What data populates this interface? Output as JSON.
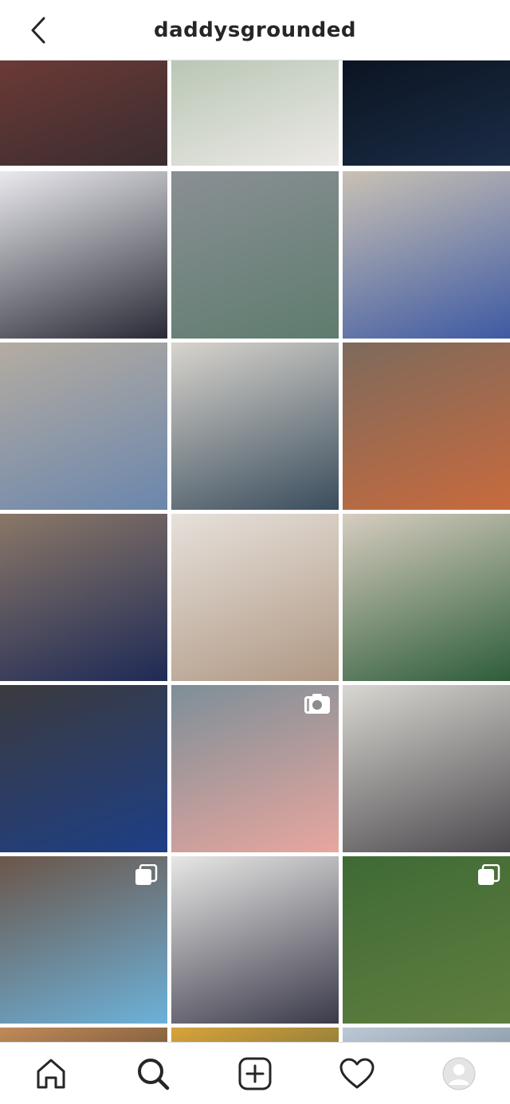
{
  "header": {
    "title": "daddysgrounded",
    "back_icon": "chevron-left-icon"
  },
  "grid": {
    "rows": [
      [
        {
          "name": "post-masked-man-festival-shirt",
          "colors": [
            "#6b3a36",
            "#3a2c30"
          ],
          "overlay": null
        },
        {
          "name": "post-cake-closeup",
          "colors": [
            "#b9c7b5",
            "#ece9e6"
          ],
          "overlay": null
        },
        {
          "name": "post-car-dashboard",
          "colors": [
            "#0b1422",
            "#1b2c46"
          ],
          "overlay": null
        }
      ],
      [
        {
          "name": "post-tv-video-game",
          "colors": [
            "#e9e9ee",
            "#2a2a36"
          ],
          "overlay": null
        },
        {
          "name": "post-boy-controller-bunkbed",
          "colors": [
            "#8a8f94",
            "#5e7c6e"
          ],
          "overlay": null
        },
        {
          "name": "post-boy-kart-shirt",
          "colors": [
            "#c9c1b4",
            "#3e5aa3"
          ],
          "overlay": null
        }
      ],
      [
        {
          "name": "post-boy-on-floor",
          "colors": [
            "#b4aca1",
            "#6b86ad"
          ],
          "overlay": null
        },
        {
          "name": "post-boy-typewriter",
          "colors": [
            "#d8d4cd",
            "#3a4d5d"
          ],
          "overlay": null
        },
        {
          "name": "post-boys-baking",
          "colors": [
            "#7e6a5c",
            "#c86a3d"
          ],
          "overlay": null
        }
      ],
      [
        {
          "name": "post-boy-very-merry",
          "colors": [
            "#8a7767",
            "#1e2a56"
          ],
          "overlay": null
        },
        {
          "name": "post-video-call-collage",
          "colors": [
            "#e6e1db",
            "#b09884"
          ],
          "overlay": null
        },
        {
          "name": "post-boys-christmas-tree",
          "colors": [
            "#d7cdc0",
            "#2e5d3a"
          ],
          "overlay": null
        }
      ],
      [
        {
          "name": "post-boy-globe-tv",
          "colors": [
            "#3b3a3e",
            "#1d3f86"
          ],
          "overlay": null
        },
        {
          "name": "post-boy-laughing",
          "colors": [
            "#7d8f98",
            "#e8a69e"
          ],
          "overlay": "video-icon"
        },
        {
          "name": "post-boys-piano",
          "colors": [
            "#d9d7d1",
            "#4c4a4e"
          ],
          "overlay": null
        }
      ],
      [
        {
          "name": "post-woman-zoom-call",
          "colors": [
            "#6b564a",
            "#6cb1d9"
          ],
          "overlay": "carousel-icon"
        },
        {
          "name": "post-couple-photo",
          "colors": [
            "#e8e7e5",
            "#3b3a4a"
          ],
          "overlay": null
        },
        {
          "name": "post-leaves-lawn",
          "colors": [
            "#3f6a35",
            "#5f7e3f"
          ],
          "overlay": "carousel-icon"
        }
      ],
      [
        {
          "name": "post-partial-row-1",
          "colors": [
            "#c18a5a",
            "#7a5a3a"
          ],
          "overlay": null
        },
        {
          "name": "post-partial-row-2",
          "colors": [
            "#d9a33a",
            "#8a7a3a"
          ],
          "overlay": null
        },
        {
          "name": "post-partial-row-3",
          "colors": [
            "#bcc8d6",
            "#8a9aa8"
          ],
          "overlay": null
        }
      ]
    ]
  },
  "nav": {
    "items": [
      {
        "name": "home",
        "icon": "home-icon"
      },
      {
        "name": "search",
        "icon": "search-icon"
      },
      {
        "name": "new-post",
        "icon": "add-post-icon"
      },
      {
        "name": "activity",
        "icon": "heart-icon"
      },
      {
        "name": "profile",
        "icon": "avatar-icon"
      }
    ]
  }
}
